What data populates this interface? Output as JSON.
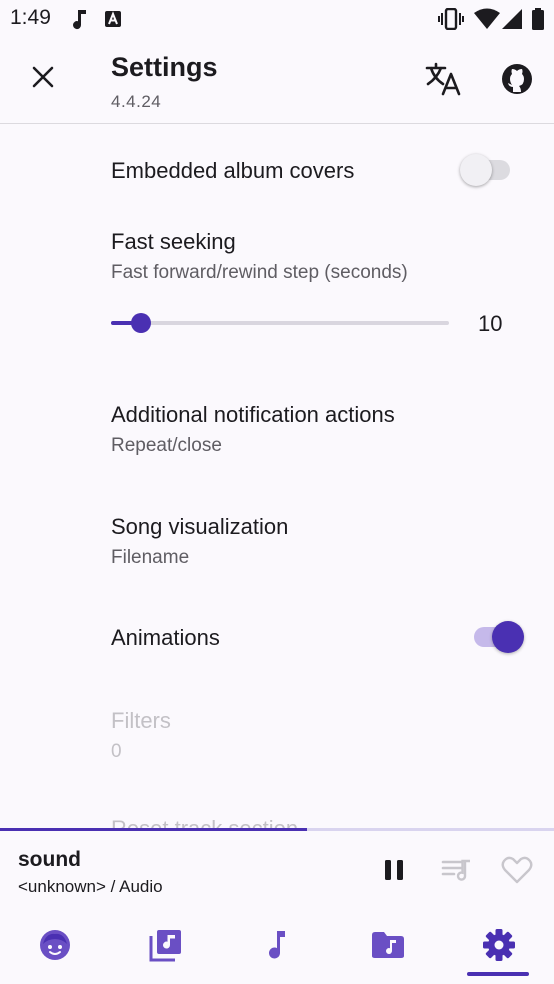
{
  "status_bar": {
    "time": "1:49",
    "icons": [
      "music-note-icon",
      "a-box-icon",
      "vibrate-icon",
      "wifi-icon",
      "signal-icon",
      "battery-icon"
    ]
  },
  "app_bar": {
    "title": "Settings",
    "version": "4.4.24",
    "actions": [
      "translate-icon",
      "github-icon"
    ],
    "close_icon": "close-icon"
  },
  "settings": {
    "embedded_covers": {
      "title": "Embedded album covers",
      "enabled": false
    },
    "fast_seeking": {
      "title": "Fast seeking",
      "subtitle": "Fast forward/rewind step (seconds)",
      "value": "10",
      "slider_fraction": 0.09
    },
    "notification_actions": {
      "title": "Additional notification actions",
      "subtitle": "Repeat/close"
    },
    "song_visualization": {
      "title": "Song visualization",
      "subtitle": "Filename"
    },
    "animations": {
      "title": "Animations",
      "enabled": true
    },
    "filters": {
      "title": "Filters",
      "subtitle": "0"
    },
    "reset_track": {
      "title": "Reset track section"
    }
  },
  "player": {
    "title": "sound",
    "subtitle": "<unknown> / Audio",
    "progress_fraction": 0.555,
    "controls": [
      "pause-icon",
      "queue-music-icon",
      "heart-outline-icon"
    ]
  },
  "bottom_nav": {
    "items": [
      "artist-face-icon",
      "album-icon",
      "music-note-icon",
      "music-folder-icon",
      "gear-icon"
    ],
    "selected_index": 4
  },
  "colors": {
    "accent": "#4a30b2",
    "background": "#fbf9fd",
    "text_primary": "#1c1b1f",
    "text_secondary": "#5f5d63",
    "disabled": "#c3c1c6"
  }
}
